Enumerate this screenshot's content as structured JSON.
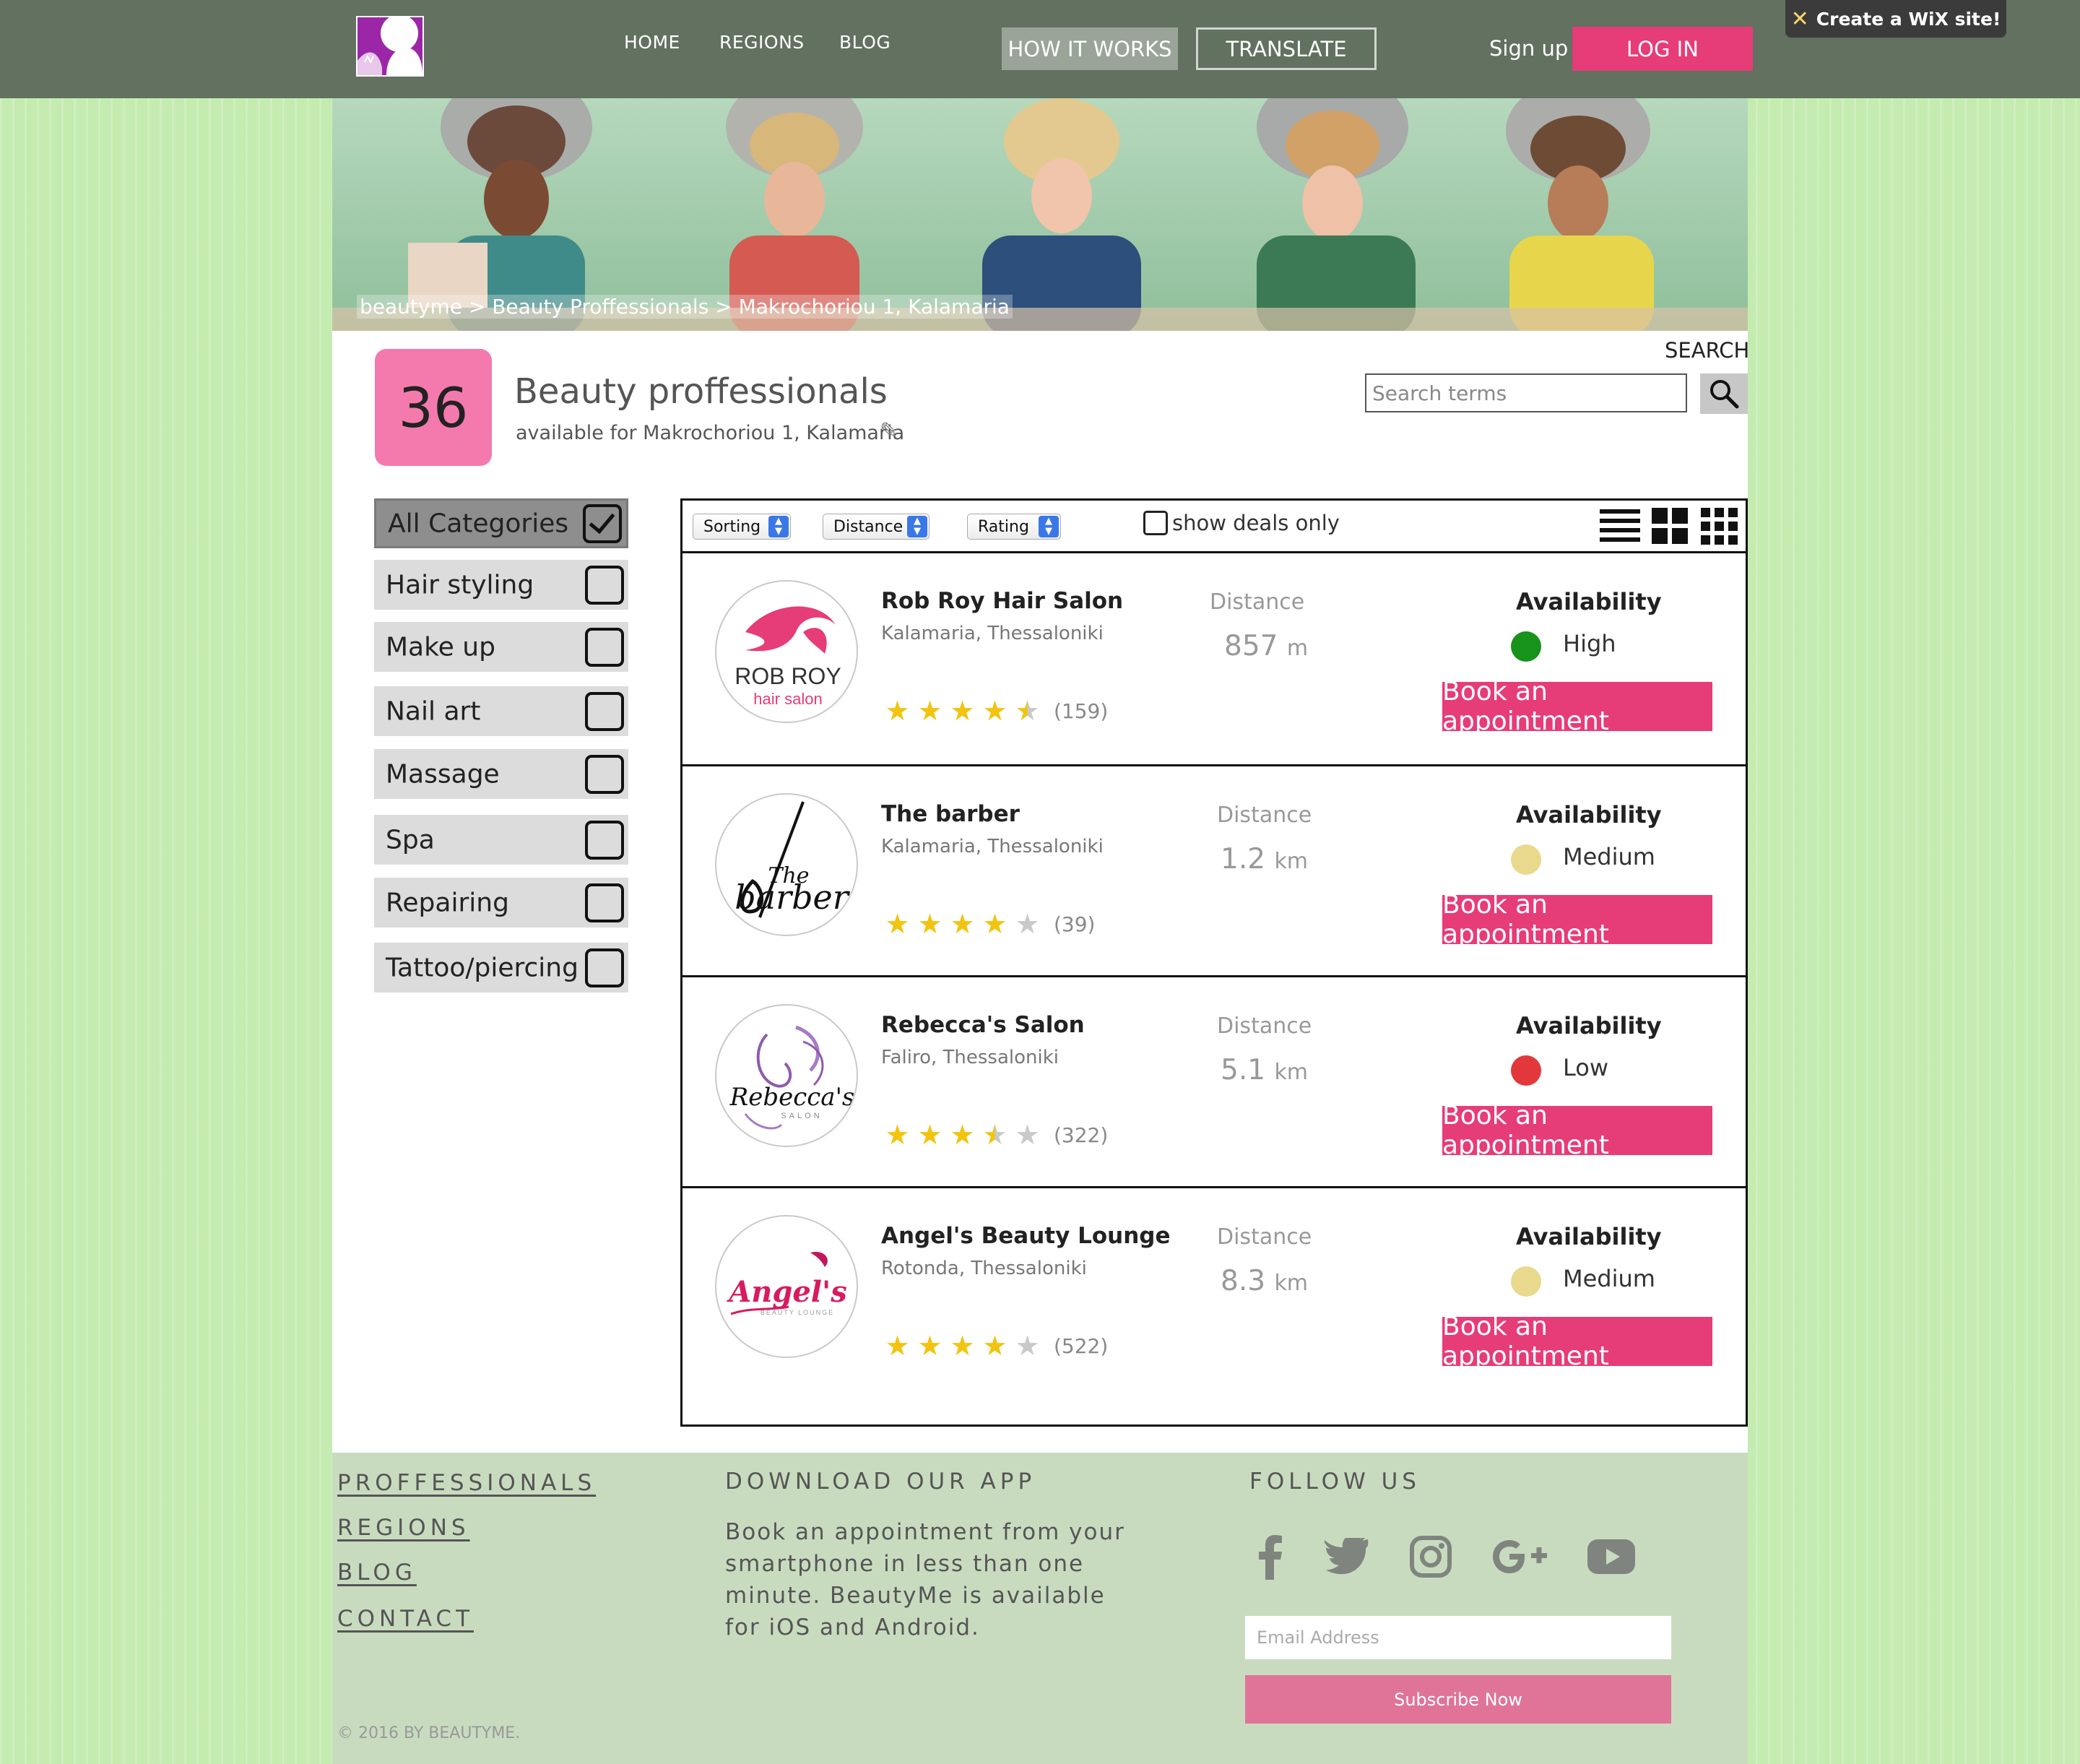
{
  "header": {
    "nav": [
      "HOME",
      "REGIONS",
      "BLOG"
    ],
    "how_it_works": "HOW IT WORKS",
    "translate": "TRANSLATE",
    "sign_up": "Sign up",
    "log_in": "LOG IN",
    "wix_banner": "Create a WiX site!"
  },
  "hero": {
    "breadcrumb": "beautyme > Beauty Proffessionals > Makrochoriou 1, Kalamaria"
  },
  "summary": {
    "count": "36",
    "title": "Beauty proffessionals",
    "subtitle": "available for Makrochoriou 1, Kalamaria"
  },
  "search": {
    "label": "SEARCH",
    "placeholder": "Search terms"
  },
  "categories": [
    {
      "label": "All Categories",
      "checked": true
    },
    {
      "label": "Hair styling",
      "checked": false
    },
    {
      "label": "Make up",
      "checked": false
    },
    {
      "label": "Nail art",
      "checked": false
    },
    {
      "label": "Massage",
      "checked": false
    },
    {
      "label": "Spa",
      "checked": false
    },
    {
      "label": "Repairing",
      "checked": false
    },
    {
      "label": "Tattoo/piercing",
      "checked": false
    }
  ],
  "toolbar": {
    "sorting": "Sorting",
    "distance": "Distance",
    "rating": "Rating",
    "show_deals": "show deals only"
  },
  "labels": {
    "distance": "Distance",
    "availability": "Availability",
    "book": "Book an appointment"
  },
  "salons": [
    {
      "name": "Rob Roy Hair Salon",
      "location": "Kalamaria, Thessaloniki",
      "distance": "857",
      "unit": "m",
      "availability": "High",
      "availability_color": "#17921a",
      "rating": 4.5,
      "reviews": "(159)",
      "logo": "robroy-logo"
    },
    {
      "name": "The barber",
      "location": "Kalamaria, Thessaloniki",
      "distance": "1.2",
      "unit": "km",
      "availability": "Medium",
      "availability_color": "#e8d98c",
      "rating": 4,
      "reviews": "(39)",
      "logo": "barber-logo"
    },
    {
      "name": "Rebecca's Salon",
      "location": "Faliro, Thessaloniki",
      "distance": "5.1",
      "unit": "km",
      "availability": "Low",
      "availability_color": "#e2383b",
      "rating": 3.5,
      "reviews": "(322)",
      "logo": "rebecca-logo"
    },
    {
      "name": "Angel's Beauty Lounge",
      "location": "Rotonda, Thessaloniki",
      "distance": "8.3",
      "unit": "km",
      "availability": "Medium",
      "availability_color": "#e8d98c",
      "rating": 4,
      "reviews": "(522)",
      "logo": "angels-logo"
    }
  ],
  "logo_text": {
    "robroy_top": "ROB ROY",
    "robroy_sub": "hair salon",
    "barber_script": "The",
    "barber_main": "barber",
    "rebecca_main": "Rebecca's",
    "rebecca_sub": "SALON",
    "angels_main": "Angel's",
    "angels_sub": "BEAUTY LOUNGE"
  },
  "footer": {
    "links": [
      "PROFFESSIONALS",
      "REGIONS",
      "BLOG",
      "CONTACT"
    ],
    "download_title": "DOWNLOAD OUR APP",
    "download_text": "Book an appointment from your smartphone in less than one minute. BeautyMe is available for iOS and Android.",
    "follow_title": "FOLLOW US",
    "social_icons": [
      "facebook-icon",
      "twitter-icon",
      "instagram-icon",
      "google-plus-icon",
      "youtube-icon"
    ],
    "email_placeholder": "Email Address",
    "subscribe": "Subscribe Now",
    "copyright": "© 2016 BY BEAUTYME."
  }
}
